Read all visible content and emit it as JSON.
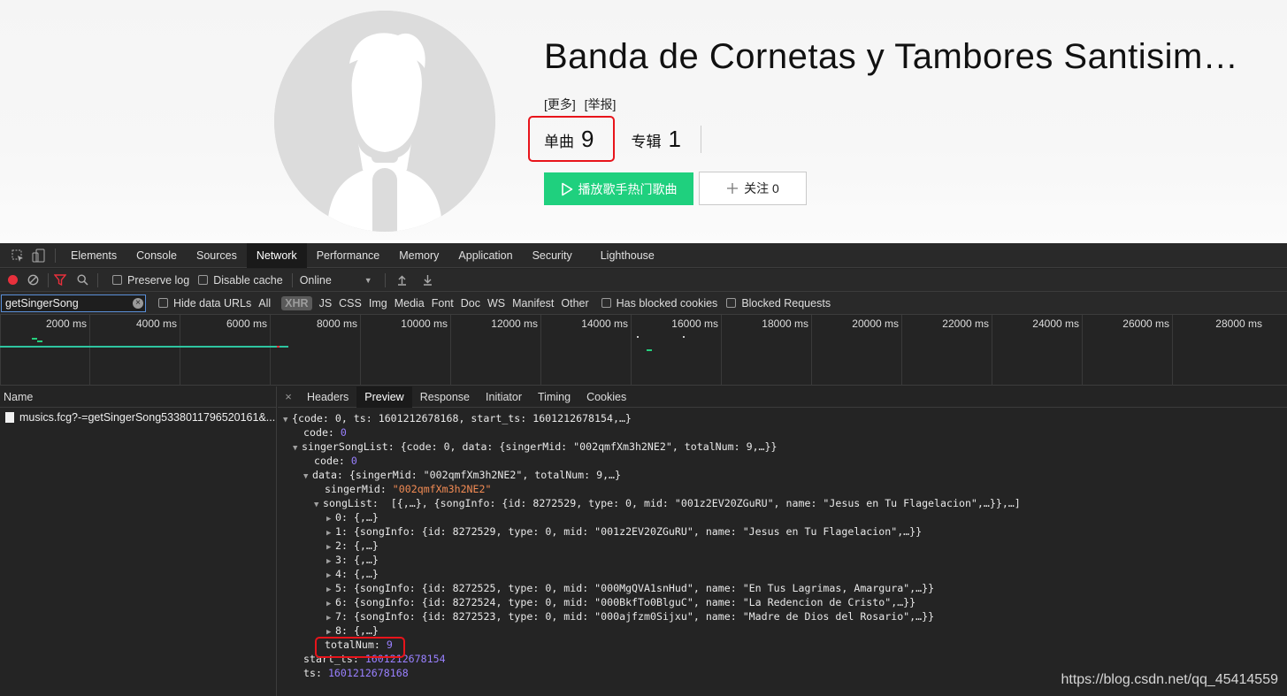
{
  "singer": {
    "name": "Banda de Cornetas y Tambores Santisim…",
    "links": [
      "[更多]",
      "[举报]"
    ],
    "songs_label": "单曲",
    "songs_count": "9",
    "albums_label": "专辑",
    "albums_count": "1",
    "play_button": "播放歌手热门歌曲",
    "follow_button": "关注 0"
  },
  "devtools": {
    "tabs": [
      "Elements",
      "Console",
      "Sources",
      "Network",
      "Performance",
      "Memory",
      "Application",
      "Security",
      "Lighthouse"
    ],
    "active_tab": "Network",
    "toolbar": {
      "preserve_log": "Preserve log",
      "disable_cache": "Disable cache",
      "throttle": "Online"
    },
    "filter": {
      "value": "getSingerSong",
      "hide_data_urls": "Hide data URLs",
      "types": [
        "All",
        "XHR",
        "JS",
        "CSS",
        "Img",
        "Media",
        "Font",
        "Doc",
        "WS",
        "Manifest",
        "Other"
      ],
      "selected_type": "XHR",
      "has_blocked_cookies": "Has blocked cookies",
      "blocked_requests": "Blocked Requests"
    },
    "timeline_ticks": [
      "2000 ms",
      "4000 ms",
      "6000 ms",
      "8000 ms",
      "10000 ms",
      "12000 ms",
      "14000 ms",
      "16000 ms",
      "18000 ms",
      "20000 ms",
      "22000 ms",
      "24000 ms",
      "26000 ms",
      "28000 ms"
    ],
    "name_header": "Name",
    "request": "musics.fcg?-=getSingerSong5338011796520161&...",
    "preview_tabs": [
      "Headers",
      "Preview",
      "Response",
      "Initiator",
      "Timing",
      "Cookies"
    ],
    "active_preview_tab": "Preview",
    "json_lines": {
      "root": "{code: 0, ts: 1601212678168, start_ts: 1601212678154,…}",
      "code_key": "code",
      "code_val": "0",
      "ssl_key": "singerSongList",
      "ssl_val": "{code: 0, data: {singerMid: \"002qmfXm3h2NE2\", totalNum: 9,…}}",
      "ssl_code_key": "code",
      "ssl_code_val": "0",
      "data_key": "data",
      "data_val": "{singerMid: \"002qmfXm3h2NE2\", totalNum: 9,…}",
      "mid_key": "singerMid",
      "mid_val": "\"002qmfXm3h2NE2\"",
      "songlist_key": "songList",
      "songlist_val": "[{,…}, {songInfo: {id: 8272529, type: 0, mid: \"001z2EV20ZGuRU\", name: \"Jesus en Tu Flagelacion\",…}},…]",
      "items": [
        {
          "k": "0",
          "v": "{,…}"
        },
        {
          "k": "1",
          "v": "{songInfo: {id: 8272529, type: 0, mid: \"001z2EV20ZGuRU\", name: \"Jesus en Tu Flagelacion\",…}}"
        },
        {
          "k": "2",
          "v": "{,…}"
        },
        {
          "k": "3",
          "v": "{,…}"
        },
        {
          "k": "4",
          "v": "{,…}"
        },
        {
          "k": "5",
          "v": "{songInfo: {id: 8272525, type: 0, mid: \"000MgQVA1snHud\", name: \"En Tus Lagrimas, Amargura\",…}}"
        },
        {
          "k": "6",
          "v": "{songInfo: {id: 8272524, type: 0, mid: \"000BkfTo0BlguC\", name: \"La Redencion de Cristo\",…}}"
        },
        {
          "k": "7",
          "v": "{songInfo: {id: 8272523, type: 0, mid: \"000ajfzm0Sijxu\", name: \"Madre de Dios del Rosario\",…}}"
        },
        {
          "k": "8",
          "v": "{,…}"
        }
      ],
      "total_key": "totalNum",
      "total_val": "9",
      "start_key": "start_ts",
      "start_val": "1601212678154",
      "ts_key": "ts",
      "ts_val": "1601212678168"
    }
  },
  "watermark": "https://blog.csdn.net/qq_45414559",
  "colors": {
    "play_green": "#1fd07e",
    "highlight_red": "#e8141b",
    "json_number": "#9980ff",
    "json_string": "#f28b54"
  }
}
